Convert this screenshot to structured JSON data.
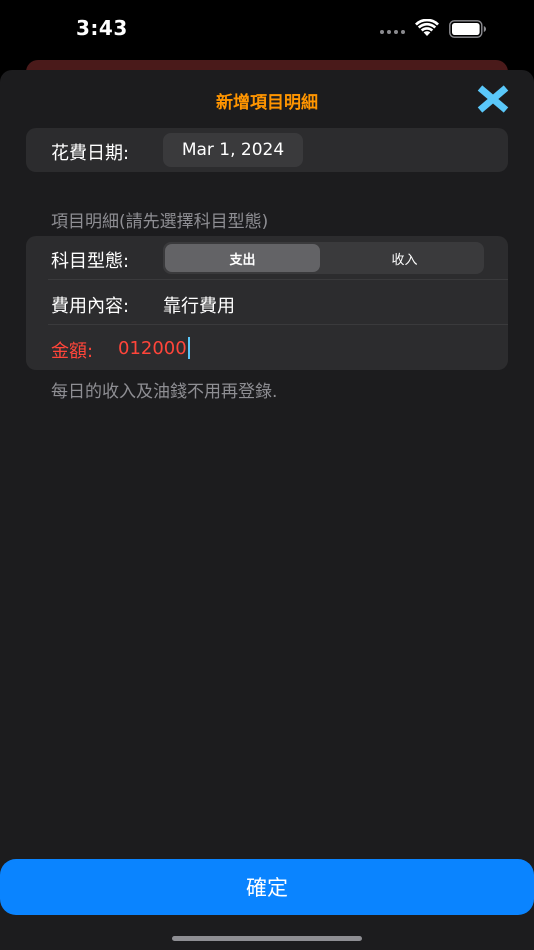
{
  "status_bar": {
    "time": "3:43"
  },
  "sheet": {
    "title": "新增項目明細",
    "date_row": {
      "label": "花費日期:",
      "value": "Mar 1, 2024"
    },
    "section_header": "項目明細(請先選擇科目型態)",
    "type_row": {
      "label": "科目型態:",
      "options": [
        "支出",
        "收入"
      ],
      "selected": "支出"
    },
    "content_row": {
      "label": "費用內容:",
      "value": "靠行費用"
    },
    "amount_row": {
      "label": "金額:",
      "value": "012000"
    },
    "footer_note": "每日的收入及油錢不用再登錄."
  },
  "confirm_button": {
    "label": "確定"
  },
  "colors": {
    "accent_title": "#ff9500",
    "close_icon": "#5ac8fa",
    "amount_text": "#ff453a",
    "confirm_button": "#0a84ff"
  },
  "icons": [
    "wifi-icon",
    "battery-icon",
    "close-icon"
  ]
}
